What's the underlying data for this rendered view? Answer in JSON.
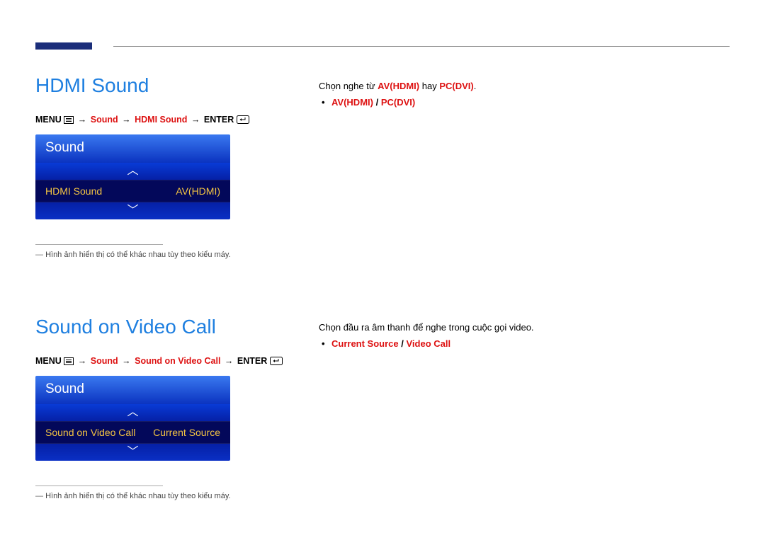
{
  "section1": {
    "title": "HDMI Sound",
    "path": {
      "menu": "MENU",
      "p1": "Sound",
      "p2": "HDMI Sound",
      "enter": "ENTER"
    },
    "osd": {
      "header": "Sound",
      "row_label": "HDMI Sound",
      "row_value": "AV(HDMI)"
    },
    "footnote": "Hình ảnh hiển thị có thể khác nhau tùy theo kiểu máy.",
    "right": {
      "intro_pre": "Chọn nghe từ ",
      "opt1": "AV(HDMI)",
      "mid": " hay ",
      "opt2": "PC(DVI)",
      "tail": ".",
      "bullet_a": "AV(HDMI)",
      "bullet_sep": " / ",
      "bullet_b": "PC(DVI)"
    }
  },
  "section2": {
    "title": "Sound on Video Call",
    "path": {
      "menu": "MENU",
      "p1": "Sound",
      "p2": "Sound on Video Call",
      "enter": "ENTER"
    },
    "osd": {
      "header": "Sound",
      "row_label": "Sound on Video Call",
      "row_value": "Current Source"
    },
    "footnote": "Hình ảnh hiển thị có thể khác nhau tùy theo kiểu máy.",
    "right": {
      "intro": "Chọn đầu ra âm thanh để nghe trong cuộc gọi video.",
      "bullet_a": "Current Source",
      "bullet_sep": " / ",
      "bullet_b": "Video Call"
    }
  }
}
